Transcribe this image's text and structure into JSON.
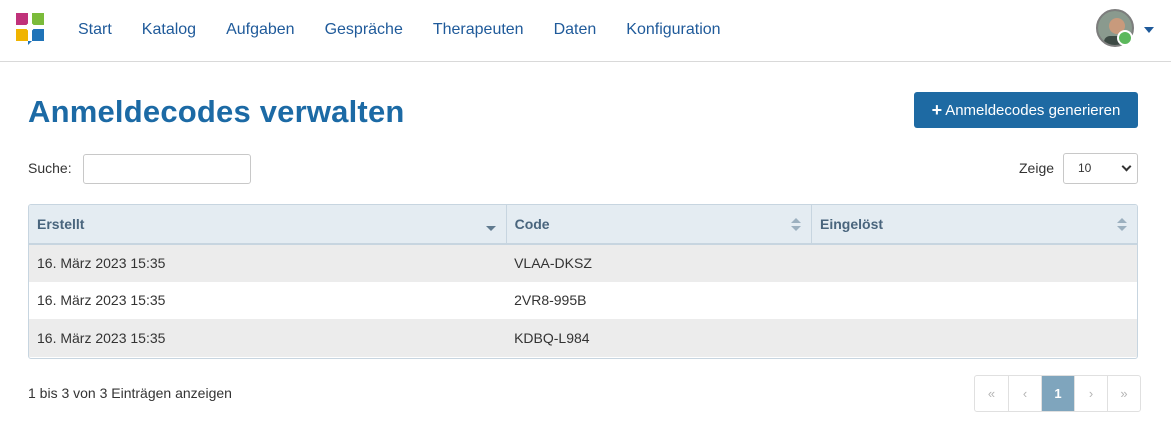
{
  "nav": {
    "items": [
      {
        "label": "Start"
      },
      {
        "label": "Katalog"
      },
      {
        "label": "Aufgaben"
      },
      {
        "label": "Gespräche"
      },
      {
        "label": "Therapeuten"
      },
      {
        "label": "Daten"
      },
      {
        "label": "Konfiguration"
      }
    ]
  },
  "page": {
    "title": "Anmeldecodes verwalten",
    "generate_button": "Anmeldecodes generieren",
    "generate_icon": "plus-icon"
  },
  "search": {
    "label": "Suche:",
    "value": ""
  },
  "length": {
    "label": "Zeige",
    "selected": "10"
  },
  "table": {
    "columns": [
      "Erstellt",
      "Code",
      "Eingelöst"
    ],
    "sorted_column": "Erstellt",
    "sort_direction": "desc",
    "rows": [
      [
        "16. März 2023 15:35",
        "VLAA-DKSZ",
        ""
      ],
      [
        "16. März 2023 15:35",
        "2VR8-995B",
        ""
      ],
      [
        "16. März 2023 15:35",
        "KDBQ-L984",
        ""
      ]
    ]
  },
  "footer": {
    "info": "1 bis 3 von 3 Einträgen anzeigen"
  },
  "pagination": {
    "first": "«",
    "prev": "‹",
    "current": "1",
    "next": "›",
    "last": "»"
  },
  "colors": {
    "brand": "#1c6aa5",
    "nav_link": "#1f5a9a",
    "button": "#1e6aa3",
    "active_page": "#7fa5bd",
    "table_header": "#e4ecf2"
  }
}
